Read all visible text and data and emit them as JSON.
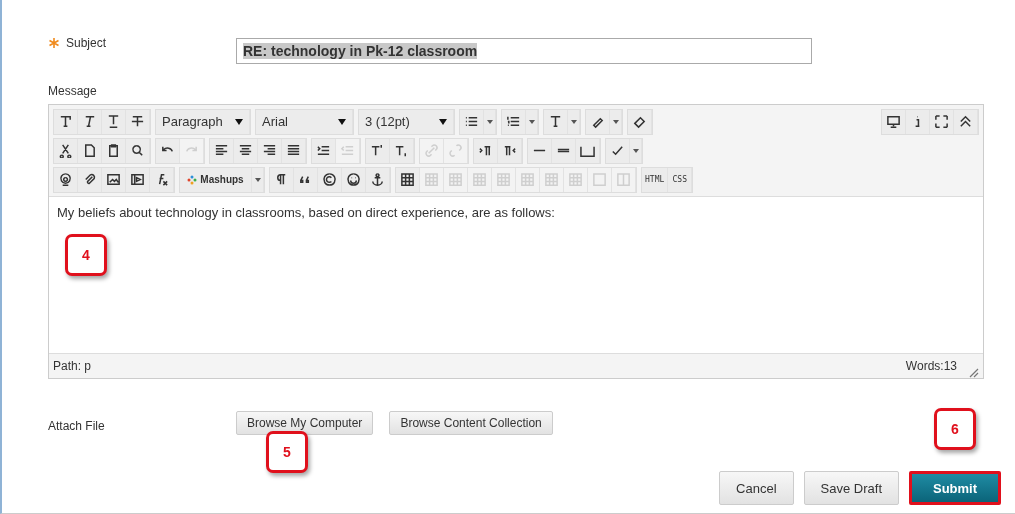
{
  "subject": {
    "label": "Subject",
    "required": true,
    "value": "RE: technology in Pk-12 classroom"
  },
  "message": {
    "label": "Message",
    "body": "My beliefs about technology in classrooms, based on direct experience, are as follows:",
    "path": "Path: p",
    "words": "Words:13"
  },
  "toolbar": {
    "rows": [
      {
        "left": [
          [
            {
              "kind": "icon",
              "disabled": false
            },
            {
              "kind": "icon",
              "disabled": false
            },
            {
              "kind": "icon",
              "disabled": false
            },
            {
              "kind": "icon",
              "disabled": false
            }
          ],
          [
            {
              "kind": "dropdown",
              "value": "Paragraph"
            }
          ],
          [
            {
              "kind": "dropdown",
              "value": "Arial"
            }
          ],
          [
            {
              "kind": "dropdown",
              "value": "3 (12pt)"
            }
          ],
          [
            {
              "kind": "split",
              "disabled": false
            }
          ],
          [
            {
              "kind": "split",
              "disabled": false
            }
          ],
          [
            {
              "kind": "split",
              "disabled": false
            }
          ],
          [
            {
              "kind": "split",
              "disabled": false
            }
          ],
          [
            {
              "kind": "icon",
              "disabled": false
            }
          ]
        ],
        "right": [
          [
            {
              "kind": "icon",
              "disabled": false
            },
            {
              "kind": "icon",
              "disabled": false
            },
            {
              "kind": "icon",
              "disabled": false
            },
            {
              "kind": "icon",
              "disabled": false
            }
          ]
        ]
      },
      {
        "left": [
          [
            {
              "kind": "icon",
              "disabled": false
            },
            {
              "kind": "icon",
              "disabled": false
            },
            {
              "kind": "icon",
              "disabled": false
            },
            {
              "kind": "icon",
              "disabled": false
            }
          ],
          [
            {
              "kind": "icon",
              "disabled": false
            },
            {
              "kind": "icon",
              "disabled": true
            }
          ],
          [
            {
              "kind": "icon",
              "disabled": false
            },
            {
              "kind": "icon",
              "disabled": false
            },
            {
              "kind": "icon",
              "disabled": false
            },
            {
              "kind": "icon",
              "disabled": false
            }
          ],
          [
            {
              "kind": "icon",
              "disabled": false
            },
            {
              "kind": "icon",
              "disabled": true
            }
          ],
          [
            {
              "kind": "icon",
              "disabled": false
            },
            {
              "kind": "icon",
              "disabled": false
            }
          ],
          [
            {
              "kind": "icon",
              "disabled": true
            },
            {
              "kind": "icon",
              "disabled": true
            }
          ],
          [
            {
              "kind": "icon",
              "disabled": false
            },
            {
              "kind": "icon",
              "disabled": false
            }
          ],
          [
            {
              "kind": "icon",
              "disabled": false
            },
            {
              "kind": "icon",
              "disabled": false
            },
            {
              "kind": "icon",
              "disabled": false
            }
          ],
          [
            {
              "kind": "split",
              "disabled": false
            }
          ]
        ],
        "right": []
      },
      {
        "left": [
          [
            {
              "kind": "icon",
              "disabled": false
            },
            {
              "kind": "icon",
              "disabled": false
            },
            {
              "kind": "icon",
              "disabled": false
            },
            {
              "kind": "icon",
              "disabled": false
            },
            {
              "kind": "icon",
              "disabled": false
            }
          ],
          [
            {
              "kind": "split-text",
              "label": "Mashups"
            }
          ],
          [
            {
              "kind": "icon",
              "disabled": false
            },
            {
              "kind": "icon",
              "disabled": false
            },
            {
              "kind": "icon",
              "disabled": false
            },
            {
              "kind": "icon",
              "disabled": false
            },
            {
              "kind": "icon",
              "disabled": false
            }
          ],
          [
            {
              "kind": "icon",
              "disabled": false
            },
            {
              "kind": "icon",
              "disabled": true
            },
            {
              "kind": "icon",
              "disabled": true
            },
            {
              "kind": "icon",
              "disabled": true
            },
            {
              "kind": "icon",
              "disabled": true
            },
            {
              "kind": "icon",
              "disabled": true
            },
            {
              "kind": "icon",
              "disabled": true
            },
            {
              "kind": "icon",
              "disabled": true
            },
            {
              "kind": "icon",
              "disabled": true
            },
            {
              "kind": "icon",
              "disabled": true
            }
          ],
          [
            {
              "kind": "text",
              "label": "HTML"
            },
            {
              "kind": "text",
              "label": "CSS"
            }
          ]
        ],
        "right": []
      }
    ]
  },
  "attach": {
    "label": "Attach File",
    "buttons": [
      "Browse My Computer",
      "Browse Content Collection"
    ]
  },
  "actions": [
    {
      "label": "Cancel",
      "primary": false
    },
    {
      "label": "Save Draft",
      "primary": false
    },
    {
      "label": "Submit",
      "primary": true
    }
  ],
  "callouts": [
    "4",
    "5",
    "6"
  ]
}
